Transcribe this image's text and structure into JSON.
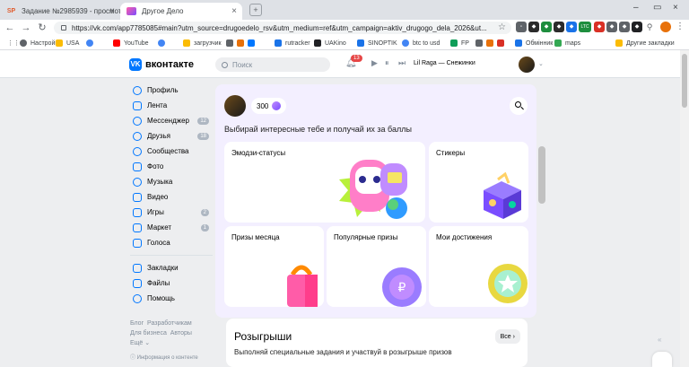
{
  "browser": {
    "tabs": [
      {
        "label": "Задание №2985939 - просмотр",
        "fav": "SP"
      },
      {
        "label": "Другое Дело",
        "fav": ""
      }
    ],
    "url": "https://vk.com/app7785085#main?utm_source=drugoedelo_rsv&utm_medium=ref&utm_campaign=aktiv_drugogo_dela_2026&ut...",
    "bookmarks": [
      "Настройки",
      "USA",
      "YouTube",
      "загрузчик",
      "rutracker",
      "UAKino",
      "SINOPTIK",
      "btc to usd",
      "FP",
      "Обмінник",
      "maps"
    ],
    "other_bookmarks": "Другие закладки",
    "ext_ltc": "LTC",
    "colors": {
      "vk_blue": "#0077ff",
      "card_bg": "#f3efff"
    }
  },
  "vk": {
    "brand": "вконтакте",
    "search_placeholder": "Поиск",
    "notifications": "13",
    "track": "Lil Raga — Снежинки"
  },
  "sidebar": {
    "items": [
      {
        "label": "Профиль",
        "count": ""
      },
      {
        "label": "Лента",
        "count": ""
      },
      {
        "label": "Мессенджер",
        "count": "12"
      },
      {
        "label": "Друзья",
        "count": "18"
      },
      {
        "label": "Сообщества",
        "count": ""
      },
      {
        "label": "Фото",
        "count": ""
      },
      {
        "label": "Музыка",
        "count": ""
      },
      {
        "label": "Видео",
        "count": ""
      },
      {
        "label": "Игры",
        "count": "2"
      },
      {
        "label": "Маркет",
        "count": "1"
      },
      {
        "label": "Голоса",
        "count": ""
      }
    ],
    "items2": [
      {
        "label": "Закладки"
      },
      {
        "label": "Файлы"
      },
      {
        "label": "Помощь"
      }
    ],
    "footer": {
      "row1a": "Блог",
      "row1b": "Разработчикам",
      "row2a": "Для бизнеса",
      "row2b": "Авторы",
      "row3": "Ещё ⌄",
      "info": "Информация о контенте"
    }
  },
  "app": {
    "points": "300",
    "subtitle": "Выбирай интересные тебе и получай их за баллы",
    "cards": {
      "emoji": "Эмодзи-статусы",
      "stickers": "Стикеры",
      "prizes": "Призы месяца",
      "popular": "Популярные призы",
      "achievements": "Мои достижения"
    },
    "section_title": "Розыгрыши",
    "section_all": "Все",
    "section_desc": "Выполняй специальные задания и участвуй в розыгрыше призов"
  }
}
